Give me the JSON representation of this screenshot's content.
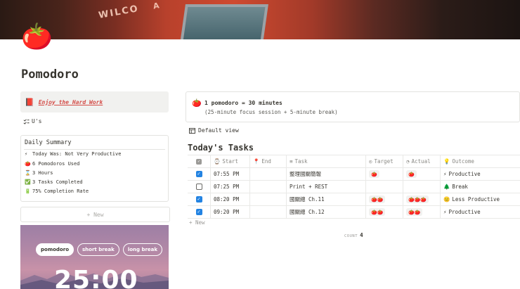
{
  "cover": {
    "brand_text": "WILCO",
    "brand_text2": "A"
  },
  "page": {
    "icon": "tomato-icon",
    "icon_glyph": "🍅",
    "title": "Pomodoro"
  },
  "quote": {
    "icon": "red-book-icon",
    "icon_glyph": "📕",
    "text": "Enjoy the Hard Work"
  },
  "us_link": {
    "icon": "checklist-icon",
    "label": "U's"
  },
  "daily_summary": {
    "heading": "Daily Summary",
    "lines": [
      {
        "icon": "lightning-icon",
        "glyph": "⚡",
        "text": "Today Was: Not Very Productive"
      },
      {
        "icon": "tomato-icon",
        "glyph": "🍅",
        "text": "6 Pomodoros Used"
      },
      {
        "icon": "hourglass-icon",
        "glyph": "⌛",
        "text": "3 Hours"
      },
      {
        "icon": "checkmark-box-icon",
        "glyph": "✅",
        "text": "3 Tasks Completed"
      },
      {
        "icon": "battery-icon",
        "glyph": "🔋",
        "text": "75% Completion Rate"
      }
    ]
  },
  "new_button": {
    "label": "+ New"
  },
  "timer": {
    "modes": [
      {
        "label": "pomodoro",
        "active": true
      },
      {
        "label": "short break",
        "active": false
      },
      {
        "label": "long break",
        "active": false
      }
    ],
    "display": "25:00"
  },
  "callout": {
    "icon": "tomato-icon",
    "glyph": "🍅",
    "line1": "1 pomodoro = 30 minutes",
    "line2": "(25-minute focus session + 5-minute break)"
  },
  "view": {
    "icon": "table-icon",
    "label": "Default view"
  },
  "tasks_title": "Today's Tasks",
  "table": {
    "headers": [
      {
        "icon": "clock-icon",
        "glyph": "⌚",
        "label": "Start"
      },
      {
        "icon": "pin-icon",
        "glyph": "📍",
        "label": "End"
      },
      {
        "icon": "text-icon",
        "glyph": "≡",
        "label": "Task"
      },
      {
        "icon": "target-icon",
        "glyph": "◎",
        "label": "Target"
      },
      {
        "icon": "gauge-icon",
        "glyph": "◔",
        "label": "Actual"
      },
      {
        "icon": "lightbulb-icon",
        "glyph": "💡",
        "label": "Outcome"
      }
    ],
    "rows": [
      {
        "done": true,
        "start": "07:55 PM",
        "end": "",
        "task": "整理國關簡報",
        "target": "🍅",
        "actual": "🍅",
        "outcome_icon": "lightning-icon",
        "outcome_glyph": "⚡",
        "outcome": "Productive"
      },
      {
        "done": false,
        "start": "07:25 PM",
        "end": "",
        "task": "Print + REST",
        "target": "",
        "actual": "",
        "outcome_icon": "tree-icon",
        "outcome_glyph": "🌲",
        "outcome": "Break"
      },
      {
        "done": true,
        "start": "08:20 PM",
        "end": "",
        "task": "國關總 Ch.11",
        "target": "🍅🍅",
        "actual": "🍅🍅🍅",
        "outcome_icon": "sleepy-face-icon",
        "outcome_glyph": "😑",
        "outcome": "Less Productive"
      },
      {
        "done": true,
        "start": "09:20 PM",
        "end": "",
        "task": "國關總 Ch.12",
        "target": "🍅🍅",
        "actual": "🍅🍅",
        "outcome_icon": "lightning-icon",
        "outcome_glyph": "⚡",
        "outcome": "Productive"
      }
    ],
    "add_label": "+ New",
    "count_label": "COUNT",
    "count_value": "4"
  }
}
